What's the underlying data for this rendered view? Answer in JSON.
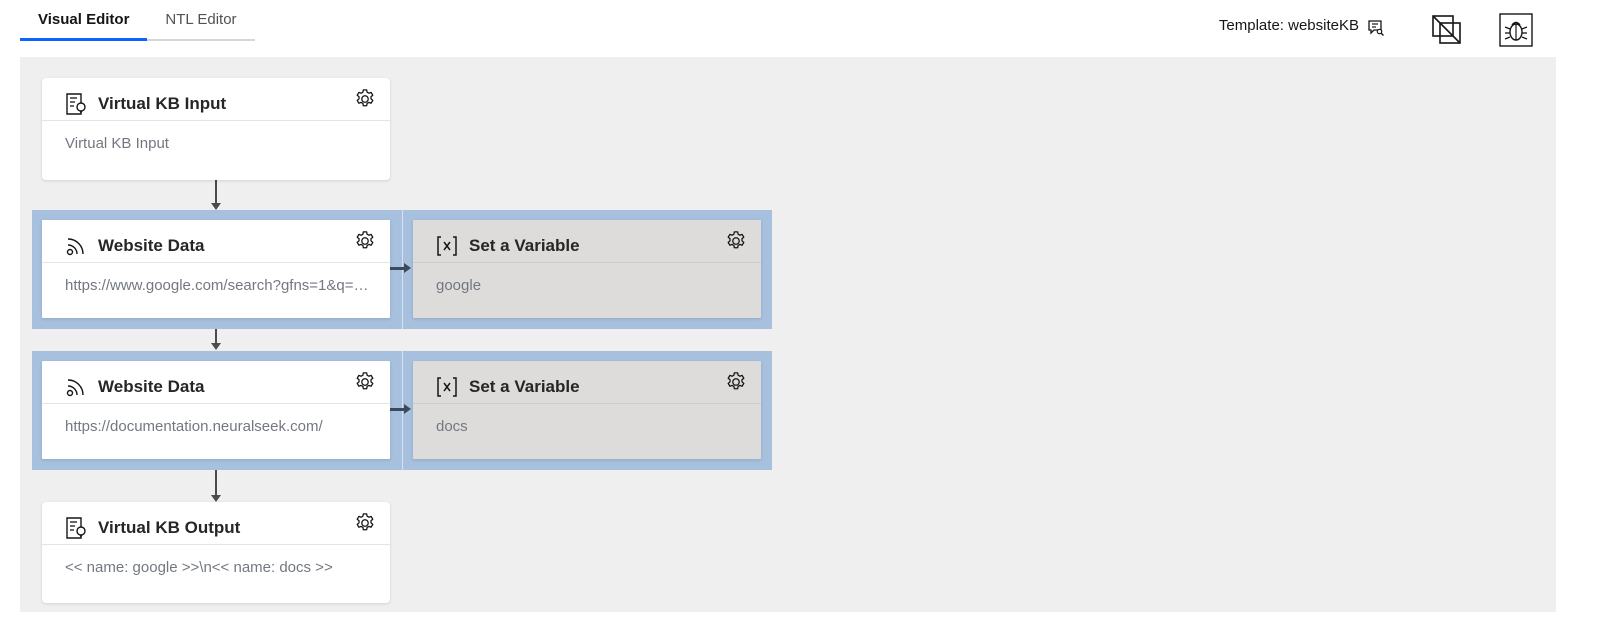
{
  "tabs": [
    {
      "label": "Visual Editor",
      "active": true
    },
    {
      "label": "NTL Editor",
      "active": false
    }
  ],
  "header": {
    "template_label": "Template: websiteKB",
    "template_icon": "template-search-icon",
    "buttons": [
      {
        "name": "disable-icon"
      },
      {
        "name": "debug-icon"
      }
    ]
  },
  "nodes": {
    "input": {
      "title": "Virtual KB Input",
      "body": "Virtual KB Input",
      "icon": "knowledge-base-icon"
    },
    "website1": {
      "title": "Website Data",
      "body": "https://www.google.com/search?gfns=1&q=…",
      "icon": "rss-feed-icon"
    },
    "var1": {
      "title": "Set a Variable",
      "body": "google",
      "icon": "variable-icon"
    },
    "website2": {
      "title": "Website Data",
      "body": "https://documentation.neuralseek.com/",
      "icon": "rss-feed-icon"
    },
    "var2": {
      "title": "Set a Variable",
      "body": "docs",
      "icon": "variable-icon"
    },
    "output": {
      "title": "Virtual KB Output",
      "body": "<< name: google >>\\n<< name: docs >>",
      "icon": "knowledge-base-icon"
    }
  },
  "colors": {
    "accent": "#0f62fe",
    "canvas": "#efefef",
    "group": "#a6c0dd",
    "variable_card": "#dedcdb"
  }
}
